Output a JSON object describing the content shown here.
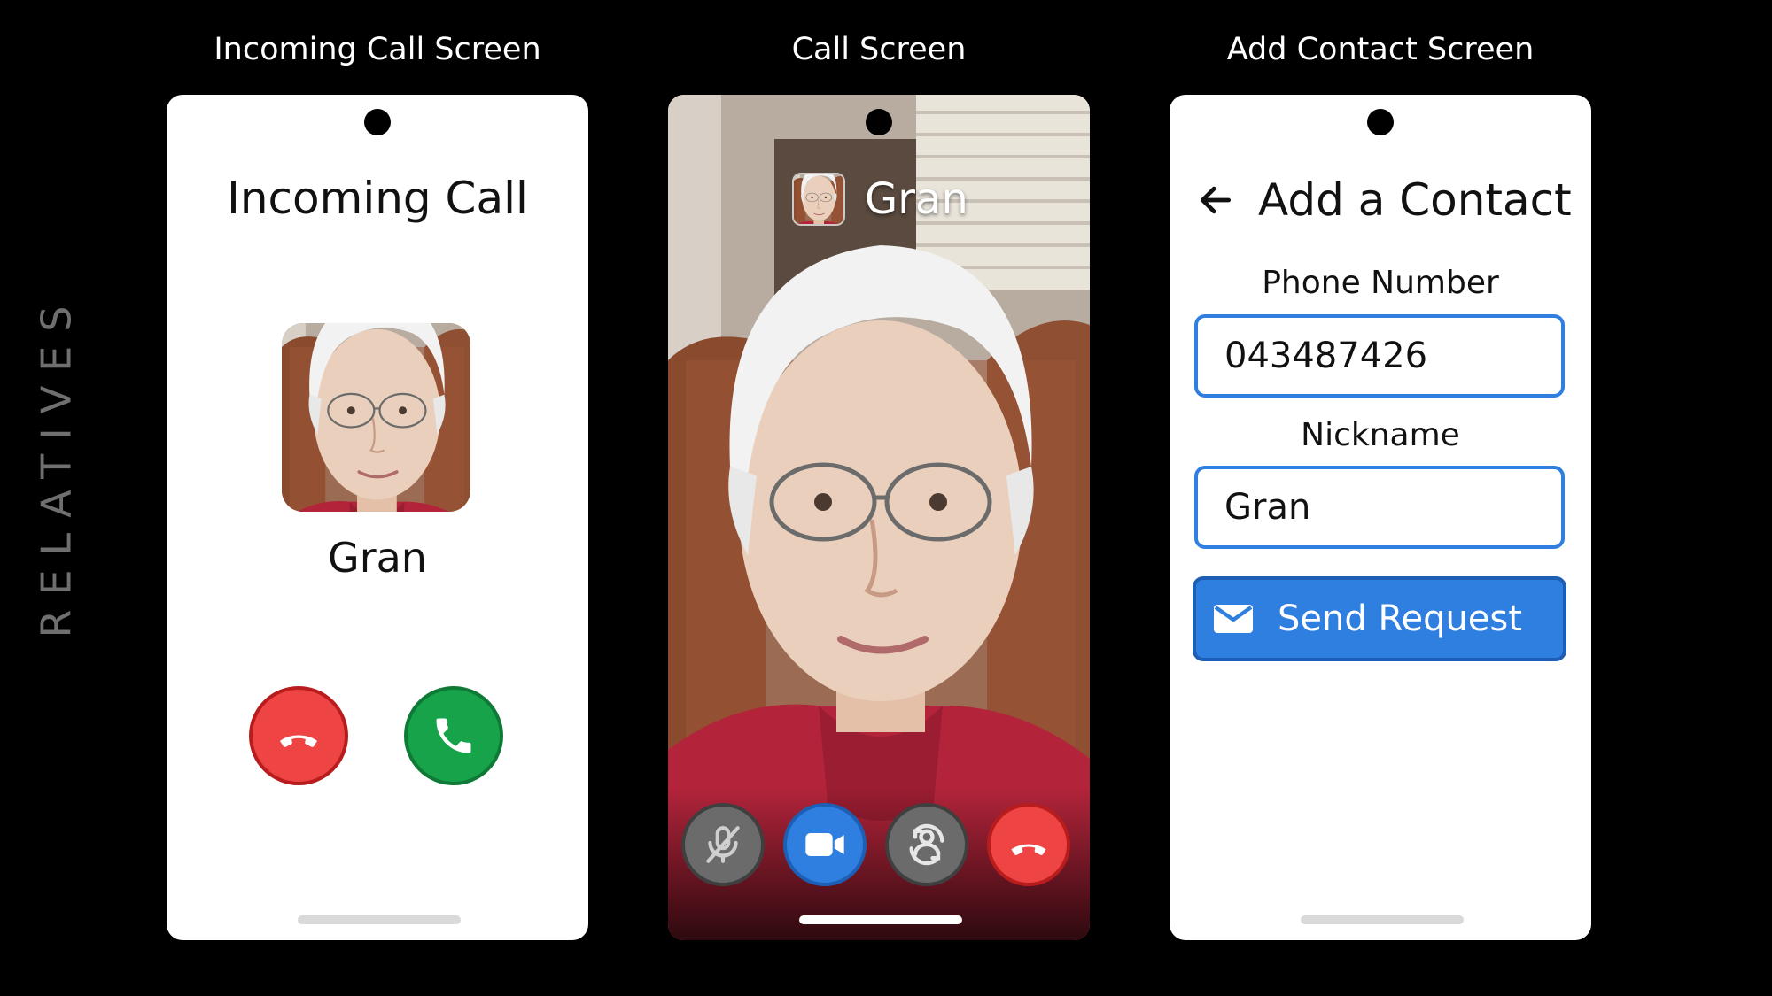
{
  "side_label": "RELATIVES",
  "screens": {
    "incoming": {
      "caption": "Incoming Call Screen",
      "title": "Incoming Call",
      "caller_name": "Gran",
      "decline_icon": "phone-hangup-icon",
      "accept_icon": "phone-icon"
    },
    "call": {
      "caption": "Call Screen",
      "caller_name": "Gran",
      "controls": [
        "mic-off-icon",
        "video-camera-icon",
        "switch-camera-icon",
        "phone-hangup-icon"
      ]
    },
    "add_contact": {
      "caption": "Add Contact Screen",
      "title": "Add a Contact",
      "back_icon": "arrow-left-icon",
      "phone_label": "Phone Number",
      "phone_value": "043487426",
      "nickname_label": "Nickname",
      "nickname_value": "Gran",
      "send_label": "Send Request",
      "send_icon": "envelope-icon"
    }
  },
  "colors": {
    "background": "#000000",
    "decline_red": "#ef4444",
    "accept_green": "#16a34a",
    "accent_blue": "#2f7fe0",
    "control_grey": "#6b6b6b"
  }
}
